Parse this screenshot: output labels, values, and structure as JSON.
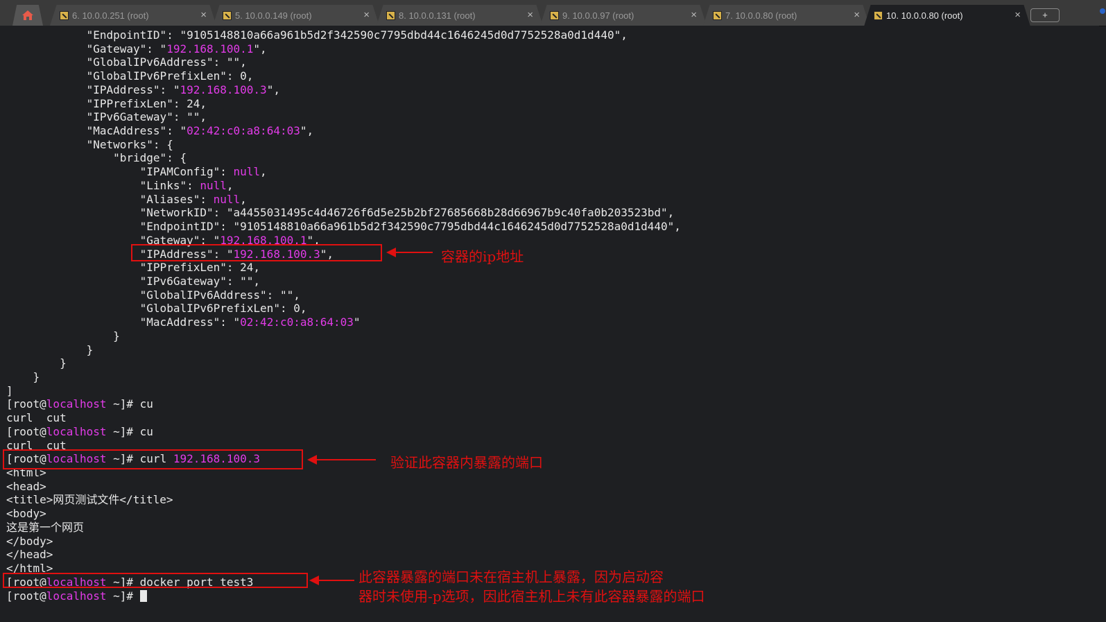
{
  "tabs": [
    {
      "label": "6. 10.0.0.251 (root)",
      "active": false
    },
    {
      "label": "5. 10.0.0.149 (root)",
      "active": false
    },
    {
      "label": "8. 10.0.0.131 (root)",
      "active": false
    },
    {
      "label": "9. 10.0.0.97 (root)",
      "active": false
    },
    {
      "label": "7. 10.0.0.80 (root)",
      "active": false
    },
    {
      "label": "10. 10.0.0.80 (root)",
      "active": true
    }
  ],
  "tab_close_glyph": "×",
  "new_tab_label": "+",
  "terminal": {
    "lines": [
      [
        "            \"EndpointID\": \"9105148810a66a961b5d2f342590c7795dbd44c1646245d0d7752528a0d1d440\","
      ],
      [
        "            \"Gateway\": \"",
        "@192.168.100.1",
        "\","
      ],
      [
        "            \"GlobalIPv6Address\": \"\","
      ],
      [
        "            \"GlobalIPv6PrefixLen\": 0,"
      ],
      [
        "            \"IPAddress\": \"",
        "@192.168.100.3",
        "\","
      ],
      [
        "            \"IPPrefixLen\": 24,"
      ],
      [
        "            \"IPv6Gateway\": \"\","
      ],
      [
        "            \"MacAddress\": \"",
        "@02:42:c0:a8:64:03",
        "\","
      ],
      [
        "            \"Networks\": {"
      ],
      [
        "                \"bridge\": {"
      ],
      [
        "                    \"IPAMConfig\": ",
        "@null",
        ","
      ],
      [
        "                    \"Links\": ",
        "@null",
        ","
      ],
      [
        "                    \"Aliases\": ",
        "@null",
        ","
      ],
      [
        "                    \"NetworkID\": \"a4455031495c4d46726f6d5e25b2bf27685668b28d66967b9c40fa0b203523bd\","
      ],
      [
        "                    \"EndpointID\": \"9105148810a66a961b5d2f342590c7795dbd44c1646245d0d7752528a0d1d440\","
      ],
      [
        "                    \"Gateway\": \"",
        "@192.168.100.1",
        "\","
      ],
      [
        "                    \"IPAddress\": \"",
        "@192.168.100.3",
        "\","
      ],
      [
        "                    \"IPPrefixLen\": 24,"
      ],
      [
        "                    \"IPv6Gateway\": \"\","
      ],
      [
        "                    \"GlobalIPv6Address\": \"\","
      ],
      [
        "                    \"GlobalIPv6PrefixLen\": 0,"
      ],
      [
        "                    \"MacAddress\": \"",
        "@02:42:c0:a8:64:03",
        "\""
      ],
      [
        "                }"
      ],
      [
        "            }"
      ],
      [
        "        }"
      ],
      [
        "    }"
      ],
      [
        "]"
      ],
      [
        "[root@",
        "@localhost",
        " ~]# cu"
      ],
      [
        "curl  cut"
      ],
      [
        "[root@",
        "@localhost",
        " ~]# cu"
      ],
      [
        "curl  cut"
      ],
      [
        "[root@",
        "@localhost",
        " ~]# curl ",
        "@192.168.100.3"
      ],
      [
        "<html>"
      ],
      [
        "<head>"
      ],
      [
        "<title>网页测试文件</title>"
      ],
      [
        "<body>"
      ],
      [
        "这是第一个网页"
      ],
      [
        "</body>"
      ],
      [
        "</head>"
      ],
      [
        "</html>"
      ],
      [
        "[root@",
        "@localhost",
        " ~]# docker port test3"
      ],
      [
        "[root@",
        "@localhost",
        " ~]# "
      ]
    ]
  },
  "annotations": {
    "ip_note": "容器的ip地址",
    "curl_note": "验证此容器内暴露的端口",
    "port_note_line1": "此容器暴露的端口未在宿主机上暴露，因为启动容",
    "port_note_line2": "器时未使用-p选项，因此宿主机上未有此容器暴露的端口"
  },
  "colors": {
    "background": "#1e1f22",
    "text": "#e8e8e8",
    "highlight_magenta": "#e23be8",
    "annotation_red": "#e01010"
  }
}
